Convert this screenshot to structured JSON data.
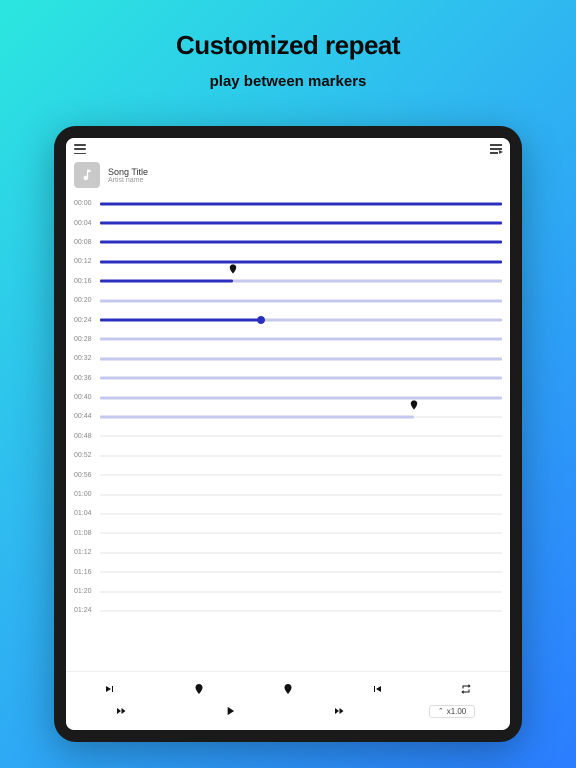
{
  "hero": {
    "title": "Customized repeat",
    "subtitle": "play between markers"
  },
  "song": {
    "title": "Song Title",
    "artist": "Artist name"
  },
  "rows": [
    {
      "label": "00:00",
      "segments": [
        {
          "start": 0,
          "end": 100,
          "style": "dark"
        }
      ]
    },
    {
      "label": "00:04",
      "segments": [
        {
          "start": 0,
          "end": 100,
          "style": "dark"
        }
      ]
    },
    {
      "label": "00:08",
      "segments": [
        {
          "start": 0,
          "end": 100,
          "style": "dark"
        }
      ]
    },
    {
      "label": "00:12",
      "segments": [
        {
          "start": 0,
          "end": 100,
          "style": "dark"
        }
      ]
    },
    {
      "label": "00:16",
      "segments": [
        {
          "start": 0,
          "end": 33,
          "style": "dark"
        },
        {
          "start": 33,
          "end": 100,
          "style": "light"
        }
      ],
      "marker": 33
    },
    {
      "label": "00:20",
      "segments": [
        {
          "start": 0,
          "end": 100,
          "style": "light"
        }
      ]
    },
    {
      "label": "00:24",
      "segments": [
        {
          "start": 0,
          "end": 40,
          "style": "dark"
        },
        {
          "start": 40,
          "end": 100,
          "style": "light"
        }
      ],
      "playhead": 40
    },
    {
      "label": "00:28",
      "segments": [
        {
          "start": 0,
          "end": 100,
          "style": "light"
        }
      ]
    },
    {
      "label": "00:32",
      "segments": [
        {
          "start": 0,
          "end": 100,
          "style": "light"
        }
      ]
    },
    {
      "label": "00:36",
      "segments": [
        {
          "start": 0,
          "end": 100,
          "style": "light"
        }
      ]
    },
    {
      "label": "00:40",
      "segments": [
        {
          "start": 0,
          "end": 100,
          "style": "light"
        }
      ]
    },
    {
      "label": "00:44",
      "segments": [
        {
          "start": 0,
          "end": 78,
          "style": "light"
        }
      ],
      "marker": 78
    },
    {
      "label": "00:48",
      "segments": []
    },
    {
      "label": "00:52",
      "segments": []
    },
    {
      "label": "00:56",
      "segments": []
    },
    {
      "label": "01:00",
      "segments": []
    },
    {
      "label": "01:04",
      "segments": []
    },
    {
      "label": "01:08",
      "segments": []
    },
    {
      "label": "01:12",
      "segments": []
    },
    {
      "label": "01:16",
      "segments": []
    },
    {
      "label": "01:20",
      "segments": []
    },
    {
      "label": "01:24",
      "segments": []
    }
  ],
  "controls": {
    "speed": "x1.00"
  }
}
